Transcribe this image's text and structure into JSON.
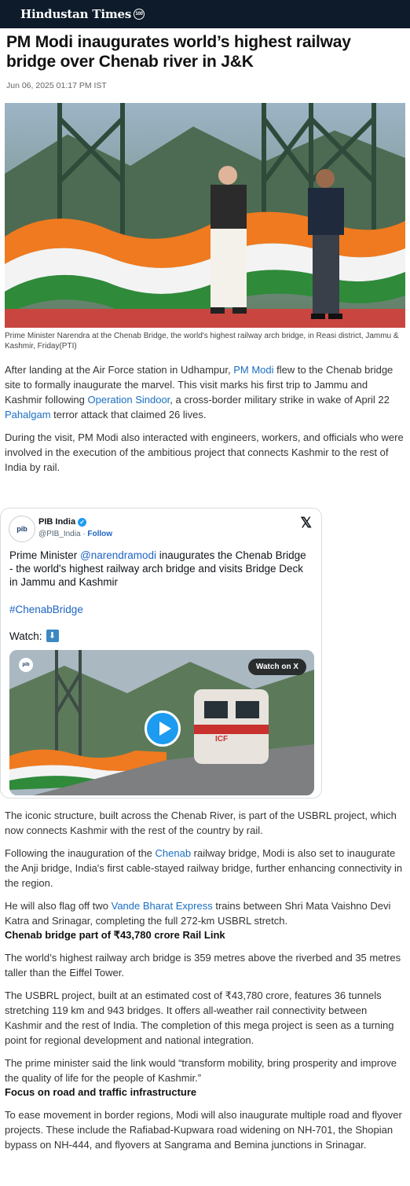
{
  "header": {
    "logo_text": "Hindustan Times",
    "logo_badge": "100"
  },
  "article": {
    "title": "PM Modi inaugurates world’s highest railway bridge over Chenab river in J&K",
    "date": "Jun 06, 2025 01:17 PM IST",
    "caption": "Prime Minister Narendra at the Chenab Bridge, the world's highest railway arch bridge, in Reasi district, Jammu & Kashmir, Friday(PTI)",
    "p1": {
      "t1": "After landing at the Air Force station in Udhampur, ",
      "link1": "PM Modi",
      "t2": " flew to the Chenab bridge site to formally inaugurate the marvel. This visit marks his first trip to Jammu and Kashmir following ",
      "link2": "Operation Sindoor",
      "t3": ", a cross-border military strike in wake of April 22 ",
      "link3": "Pahalgam",
      "t4": " terror attack that claimed 26 lives."
    },
    "p2": "During the visit, PM Modi also interacted with engineers, workers, and officials who were involved in the execution of the ambitious project that connects Kashmir to the rest of India by rail.",
    "p3": "The iconic structure, built across the Chenab River, is part of the USBRL project, which now connects Kashmir with the rest of the country by rail.",
    "p4": {
      "t1": "Following the inauguration of the ",
      "link": "Chenab",
      "t2": " railway bridge, Modi is also set to inaugurate the Anji bridge, India's first cable-stayed railway bridge, further enhancing connectivity in the region."
    },
    "p5": {
      "t1": "He will also flag off two ",
      "link": "Vande Bharat Express",
      "t2": " trains between Shri Mata Vaishno Devi Katra and Srinagar, completing the full 272-km USBRL stretch."
    },
    "h_rail": "Chenab bridge part of ₹43,780 crore Rail Link",
    "p6": "The world’s highest railway arch bridge is 359 metres above the riverbed and 35 metres taller than the Eiffel Tower.",
    "p7": "The USBRL project, built at an estimated cost of ₹43,780 crore, features 36 tunnels stretching 119 km and 943 bridges. It offers all-weather rail connectivity between Kashmir and the rest of India. The completion of this mega project is seen as a turning point for regional development and national integration.",
    "p8": "The prime minister said the link would “transform mobility, bring prosperity and improve the quality of life for the people of Kashmir.”",
    "h_road": "Focus on road and traffic infrastructure",
    "p9": "To ease movement in border regions, Modi will also inaugurate multiple road and flyover projects. These include the Rafiabad-Kupwara road widening on NH-701, the Shopian bypass on NH-444, and flyovers at Sangrama and Bemina junctions in Srinagar."
  },
  "tweet": {
    "name": "PIB India",
    "handle": "@PIB_India",
    "follow": "Follow",
    "avatar_text": "pib",
    "text_pre": "Prime Minister ",
    "mention": "@narendramodi",
    "text_post": " inaugurates the Chenab Bridge - the world's highest railway arch bridge and visits Bridge Deck in Jammu and Kashmir",
    "hashtag": "#ChenabBridge",
    "watch": "Watch:",
    "watch_on_x": "Watch on X",
    "train_label": "ICF"
  }
}
